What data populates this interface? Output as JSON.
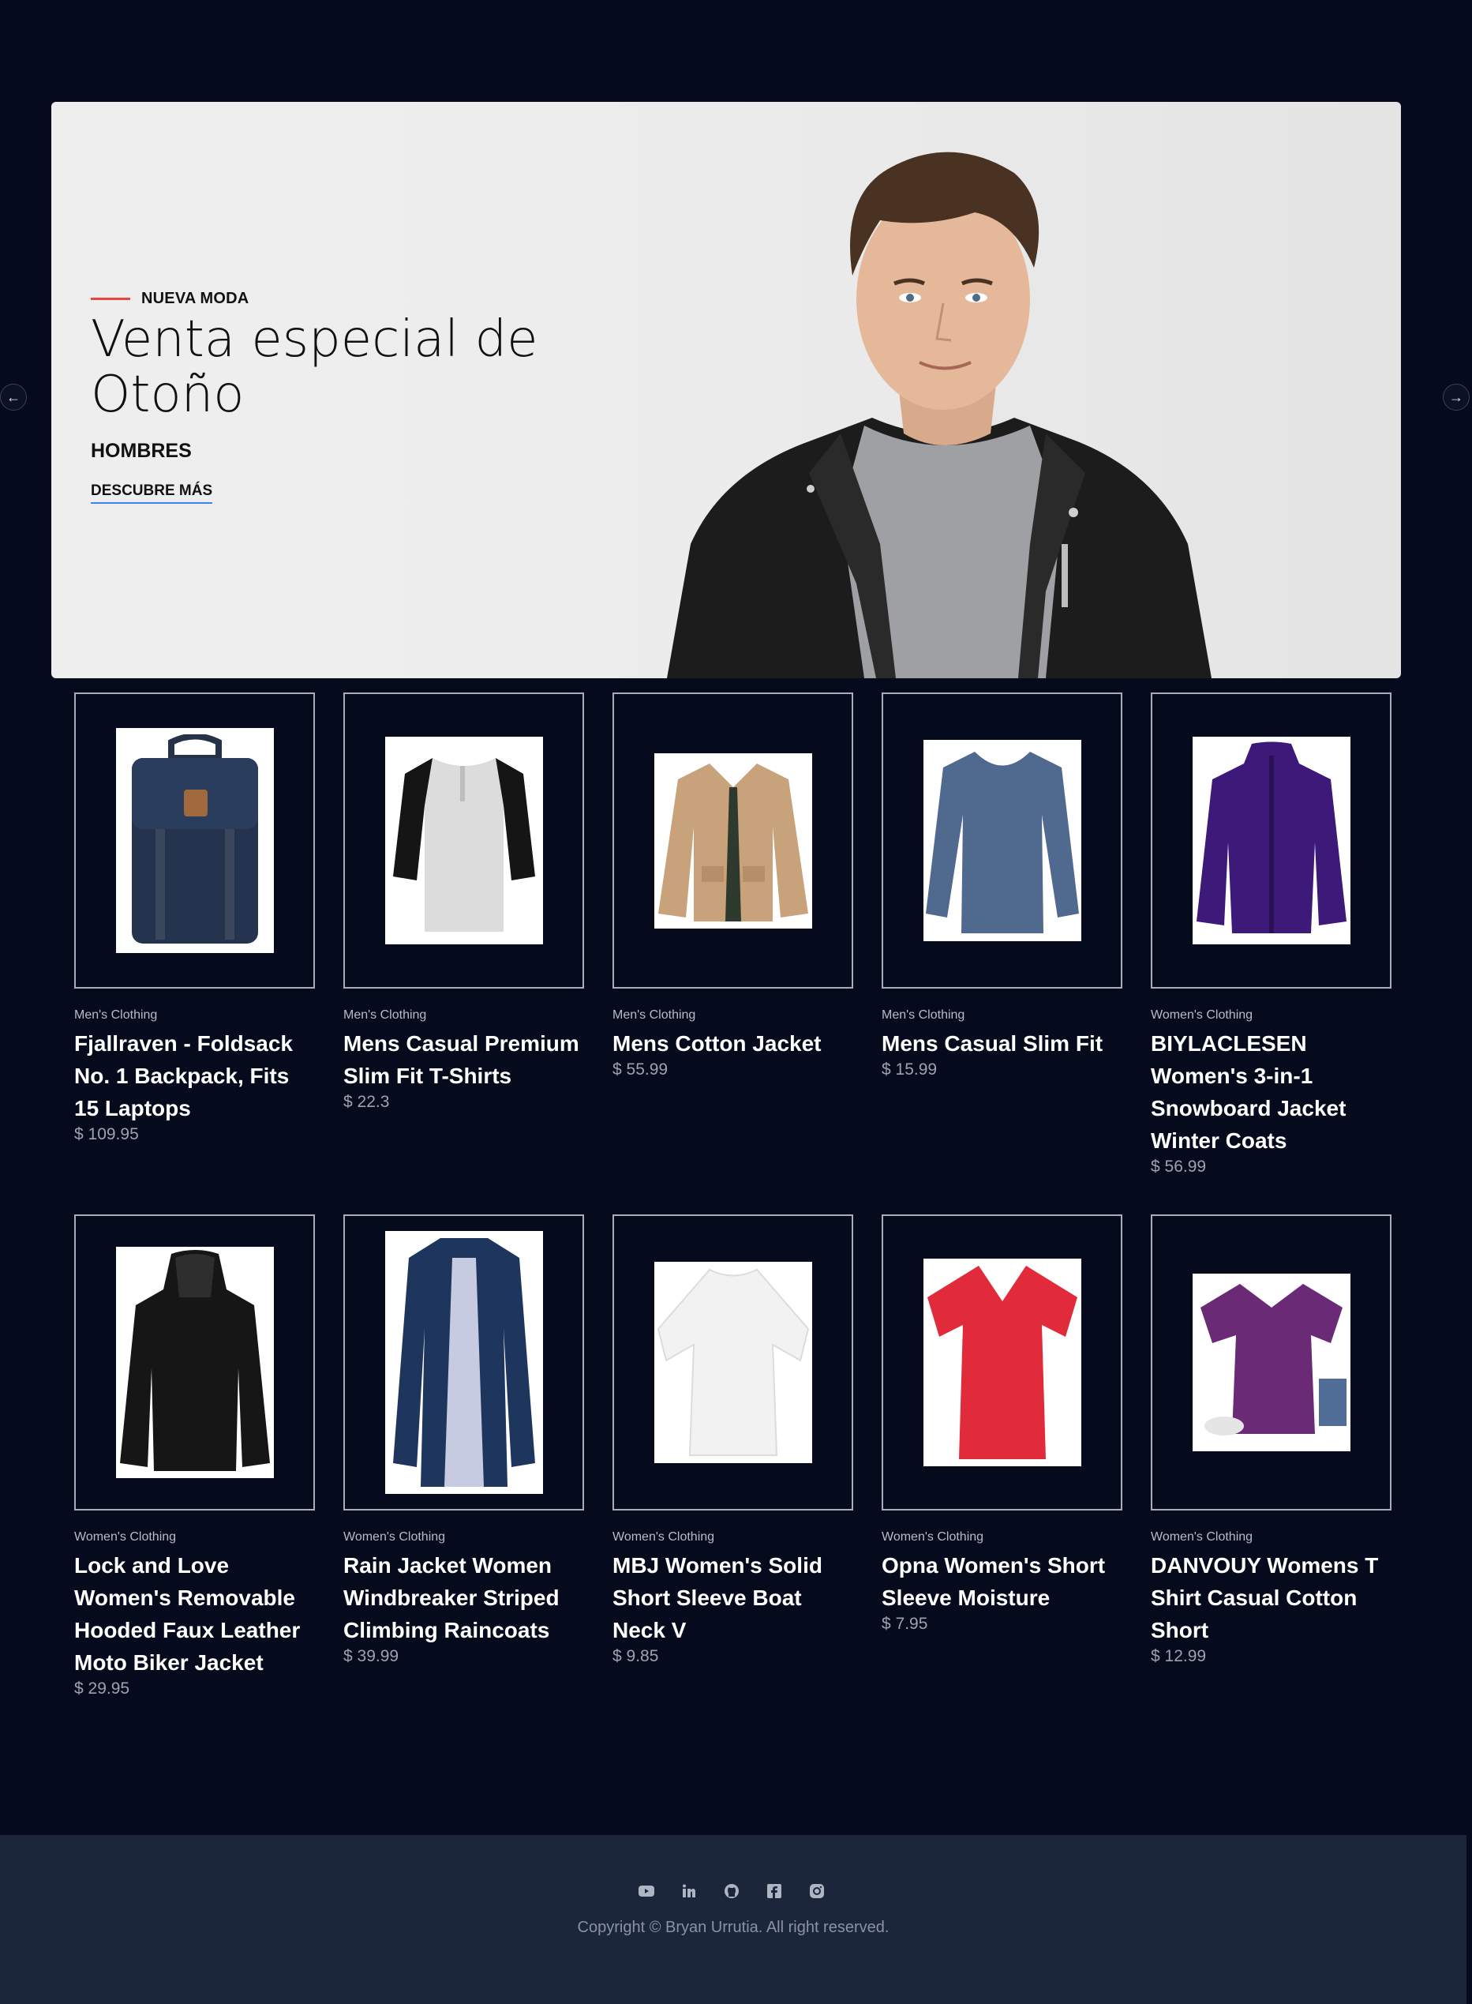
{
  "hero": {
    "eyebrow": "NUEVA MODA",
    "title": "Venta especial de Otoño",
    "subtitle": "HOMBRES",
    "cta": "DESCUBRE MÁS"
  },
  "carousel": {
    "prev_icon": "arrow-left-icon",
    "next_icon": "arrow-right-icon"
  },
  "products": [
    {
      "category": "Men's Clothing",
      "name": "Fjallraven - Foldsack No. 1 Backpack, Fits 15 Laptops",
      "price": "$ 109.95",
      "image": "backpack"
    },
    {
      "category": "Men's Clothing",
      "name": "Mens Casual Premium Slim Fit T-Shirts",
      "price": "$ 22.3",
      "image": "raglan-shirt"
    },
    {
      "category": "Men's Clothing",
      "name": "Mens Cotton Jacket",
      "price": "$ 55.99",
      "image": "cotton-jacket"
    },
    {
      "category": "Men's Clothing",
      "name": "Mens Casual Slim Fit",
      "price": "$ 15.99",
      "image": "long-sleeve-shirt"
    },
    {
      "category": "Women's Clothing",
      "name": "BIYLACLESEN Women's 3-in-1 Snowboard Jacket Winter Coats",
      "price": "$ 56.99",
      "image": "snowboard-jacket"
    },
    {
      "category": "Women's Clothing",
      "name": "Lock and Love Women's Removable Hooded Faux Leather Moto Biker Jacket",
      "price": "$ 29.95",
      "image": "leather-jacket"
    },
    {
      "category": "Women's Clothing",
      "name": "Rain Jacket Women Windbreaker Striped Climbing Raincoats",
      "price": "$ 39.99",
      "image": "rain-jacket"
    },
    {
      "category": "Women's Clothing",
      "name": "MBJ Women's Solid Short Sleeve Boat Neck V",
      "price": "$ 9.85",
      "image": "white-top"
    },
    {
      "category": "Women's Clothing",
      "name": "Opna Women's Short Sleeve Moisture",
      "price": "$ 7.95",
      "image": "red-tshirt"
    },
    {
      "category": "Women's Clothing",
      "name": "DANVOUY Womens T Shirt Casual Cotton Short",
      "price": "$ 12.99",
      "image": "purple-tshirt"
    }
  ],
  "colors": {
    "background": "#050a1c",
    "footer": "#1b263b",
    "accent": "#e84545",
    "link_underline": "#3b82f6"
  },
  "footer": {
    "social_icons": [
      "youtube-icon",
      "linkedin-icon",
      "github-icon",
      "facebook-icon",
      "instagram-icon"
    ],
    "copyright": "Copyright © Bryan Urrutia. All right reserved."
  }
}
